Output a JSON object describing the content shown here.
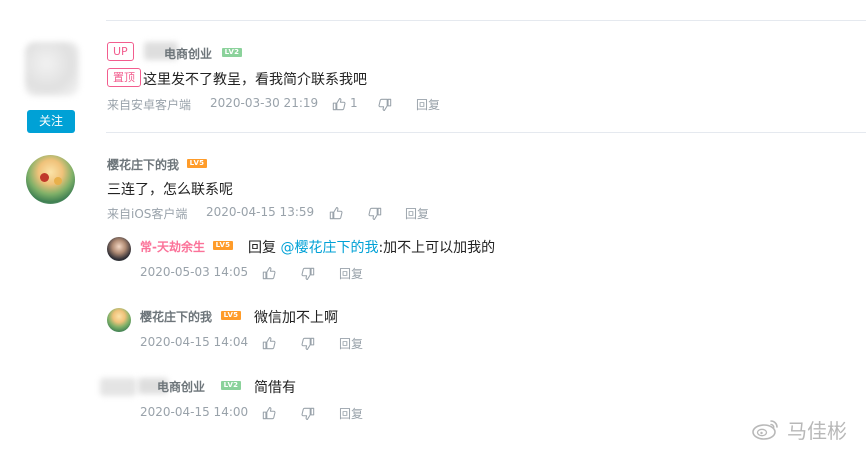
{
  "comments": [
    {
      "tags": [
        "UP",
        "置顶"
      ],
      "user": "电商创业",
      "level": "LV2",
      "follow_label": "关注",
      "text": "这里发不了教呈，看我简介联系我吧",
      "source": "来自安卓客户端",
      "time": "2020-03-30 21:19",
      "likes": "1",
      "reply_label": "回复"
    },
    {
      "user": "樱花庄下的我",
      "level": "LV5",
      "text": "三连了，怎么联系呢",
      "source": "来自iOS客户端",
      "time": "2020-04-15 13:59",
      "reply_label": "回复",
      "replies": [
        {
          "user": "常-天劫余生",
          "level": "LV5",
          "reply_prefix": "回复",
          "mention": "@樱花庄下的我",
          "text": ":加不上可以加我的",
          "time": "2020-05-03 14:05",
          "reply_label": "回复"
        },
        {
          "user": "樱花庄下的我",
          "level": "LV5",
          "text": "微信加不上啊",
          "time": "2020-04-15 14:04",
          "reply_label": "回复"
        },
        {
          "user": "电商创业",
          "level": "LV2",
          "text": "简借有",
          "time": "2020-04-15 14:00",
          "reply_label": "回复"
        }
      ]
    }
  ],
  "watermark": {
    "text": "马佳彬",
    "icon": "weibo-icon"
  },
  "colors": {
    "accent": "#00a1d6",
    "pink": "#fb7299",
    "meta": "#99a2aa",
    "lv2": "#8bd29b",
    "lv5": "#ff9c2a"
  }
}
